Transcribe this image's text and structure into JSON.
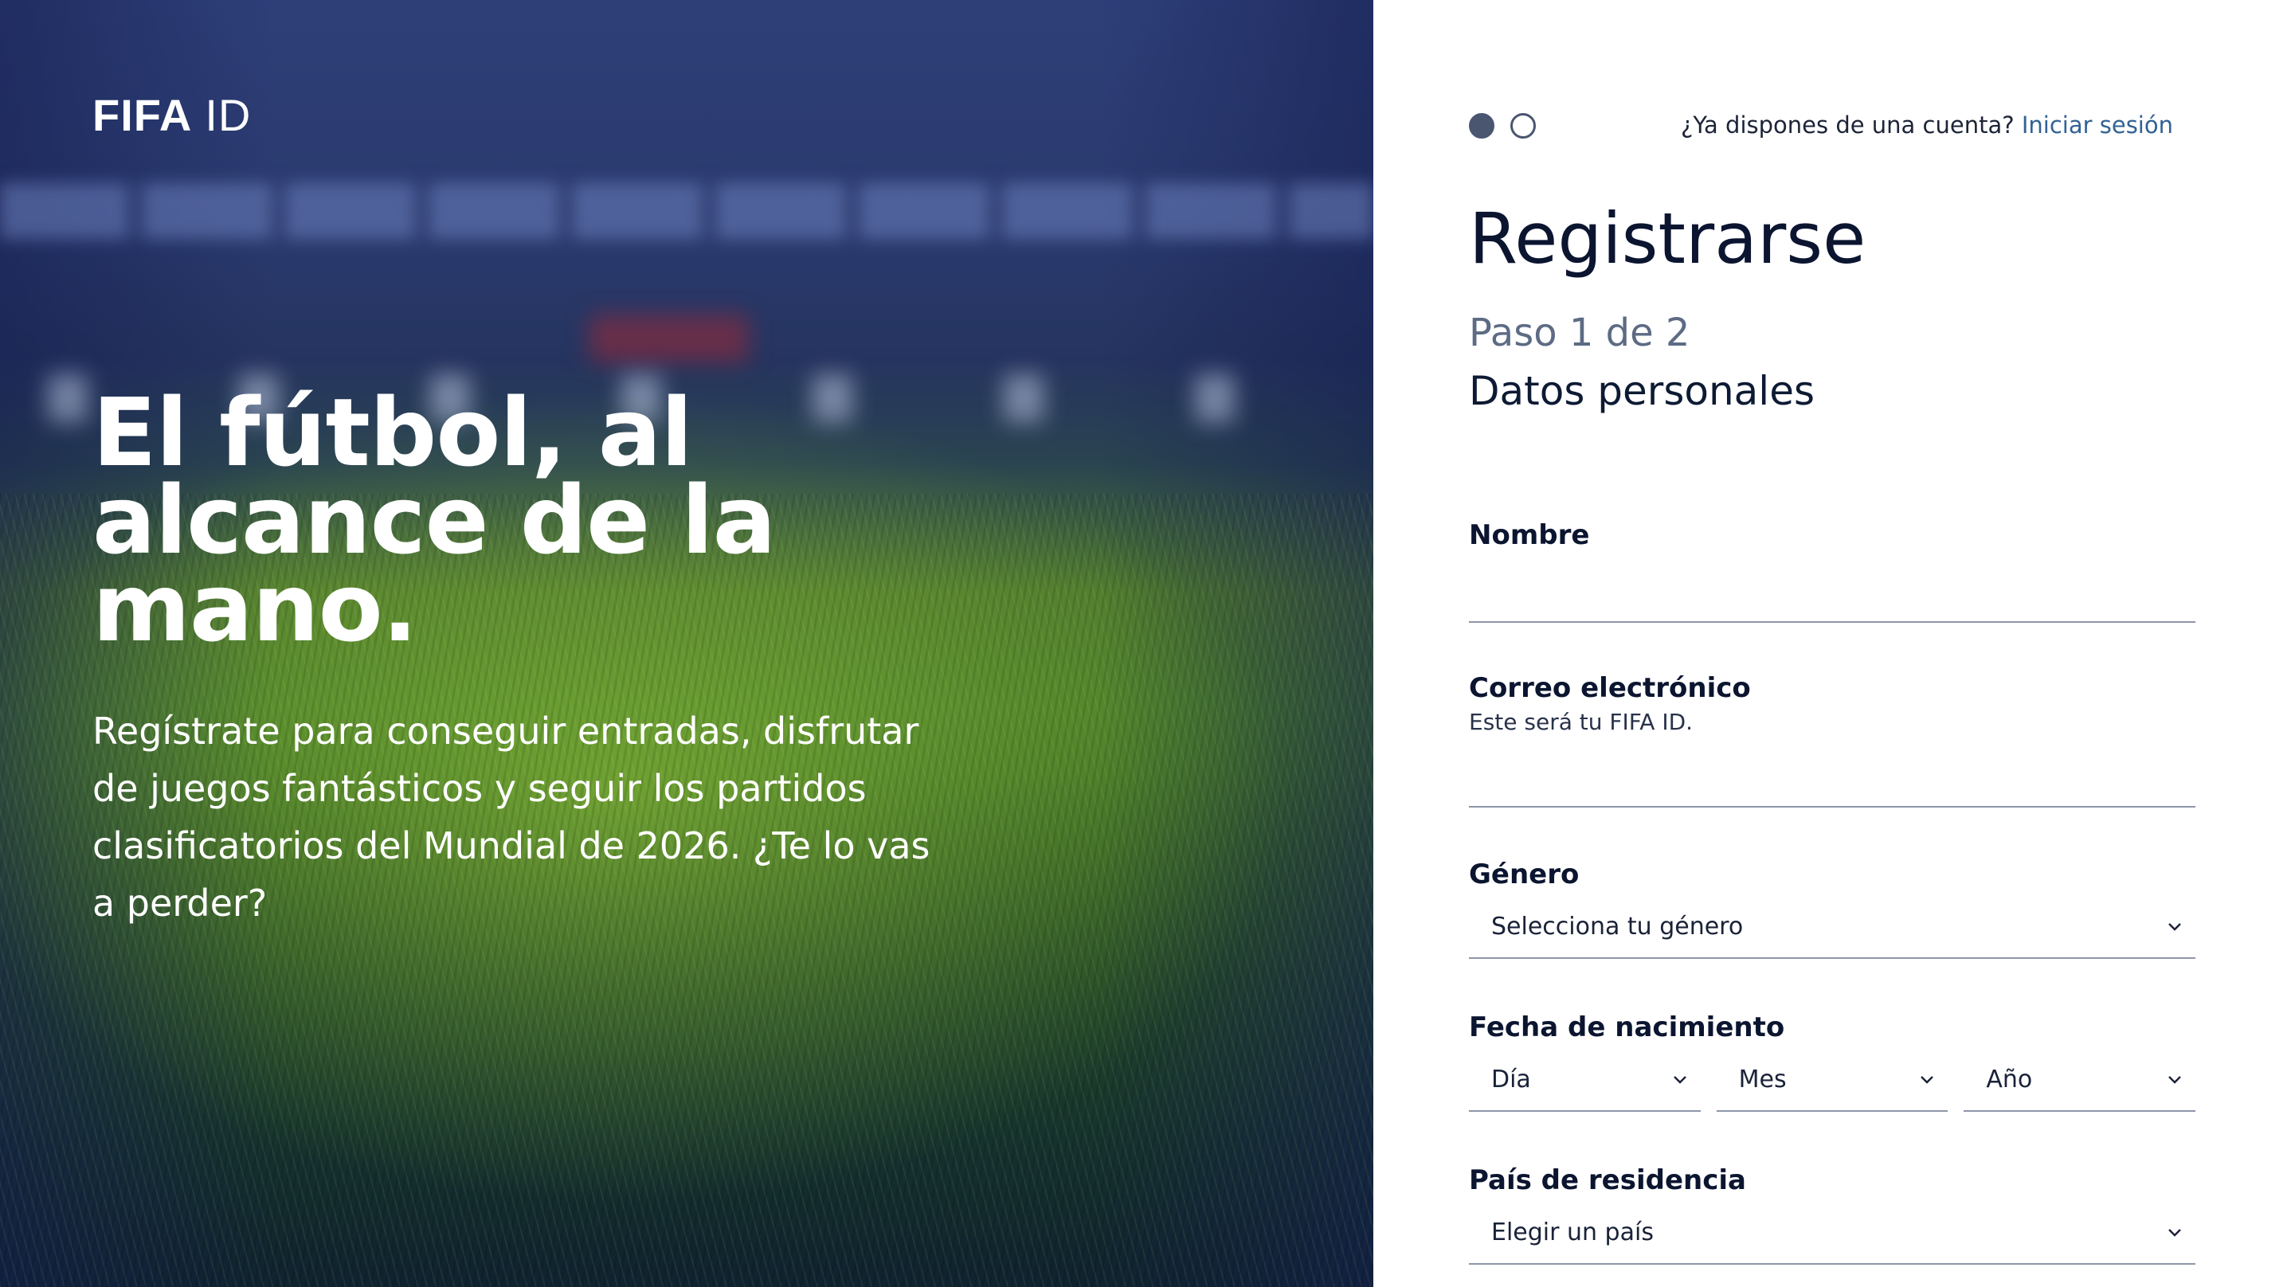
{
  "hero": {
    "logo_main": "FIFA",
    "logo_suffix": "ID",
    "headline_lines": [
      "El fútbol, al",
      "alcance de la",
      "mano."
    ],
    "subtext_lines": [
      "Regístrate para conseguir entradas, disfrutar",
      "de juegos fantásticos y seguir los partidos",
      "clasificatorios del Mundial de 2026. ¿Te lo vas",
      "a perder?"
    ]
  },
  "header": {
    "account_prompt": "¿Ya dispones de una cuenta?",
    "login_link": "Iniciar sesión",
    "step_dots": 2,
    "active_step": 1
  },
  "form": {
    "title": "Registrarse",
    "step": "Paso 1 de 2",
    "section": "Datos personales",
    "name": {
      "label": "Nombre",
      "value": ""
    },
    "email": {
      "label": "Correo electrónico",
      "hint": "Este será tu FIFA ID.",
      "value": ""
    },
    "gender": {
      "label": "Género",
      "placeholder": "Selecciona tu género"
    },
    "birthdate": {
      "label": "Fecha de nacimiento",
      "day": "Día",
      "month": "Mes",
      "year": "Año"
    },
    "country": {
      "label": "País de residencia",
      "placeholder": "Elegir un país"
    }
  },
  "colors": {
    "link": "#326295",
    "text_dark": "#0b1530",
    "muted": "#5d6b84",
    "underline": "#8d96a8",
    "dot": "#4a5570"
  },
  "icons": {
    "dropdown": "chevron-down-icon"
  }
}
